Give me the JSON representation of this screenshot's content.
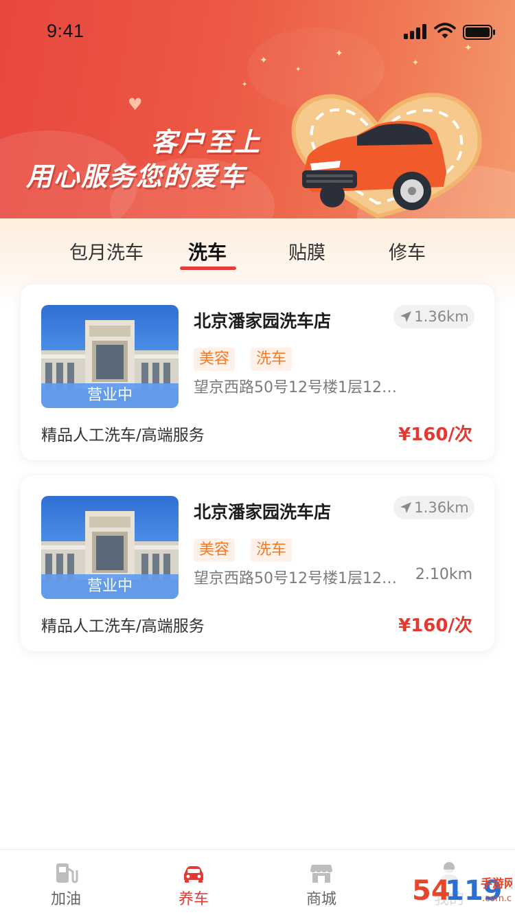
{
  "status_bar": {
    "time": "9:41"
  },
  "banner": {
    "slogan_line1": "客户至上",
    "slogan_line2": "用心服务您的爱车"
  },
  "tabs": [
    {
      "label": "包月洗车",
      "active": false
    },
    {
      "label": "洗车",
      "active": true
    },
    {
      "label": "贴膜",
      "active": false
    },
    {
      "label": "修车",
      "active": false
    }
  ],
  "stores": [
    {
      "name": "北京潘家园洗车店",
      "distance": "1.36km",
      "status": "营业中",
      "tags": [
        "美容",
        "洗车"
      ],
      "address": "望京西路50号12号楼1层12…",
      "address_distance": "",
      "service": "精品人工洗车/高端服务",
      "price": "¥160/次"
    },
    {
      "name": "北京潘家园洗车店",
      "distance": "1.36km",
      "status": "营业中",
      "tags": [
        "美容",
        "洗车"
      ],
      "address": "望京西路50号12号楼1层12…",
      "address_distance": "2.10km",
      "service": "精品人工洗车/高端服务",
      "price": "¥160/次"
    }
  ],
  "tabbar": [
    {
      "label": "加油",
      "icon": "fuel-pump-icon",
      "active": false
    },
    {
      "label": "养车",
      "icon": "car-icon",
      "active": true
    },
    {
      "label": "商城",
      "icon": "store-icon",
      "active": false
    },
    {
      "label": "我的",
      "icon": "user-icon",
      "active": false
    }
  ],
  "watermark": {
    "text": "54119手游网",
    "subtext": ".com.cn"
  },
  "colors": {
    "accent": "#e23a32",
    "banner_start": "#e8473f",
    "banner_end": "#f49a6e",
    "tag_bg": "#fff1e8",
    "tag_text": "#f07a2a",
    "open_band": "#5f9bf0"
  }
}
